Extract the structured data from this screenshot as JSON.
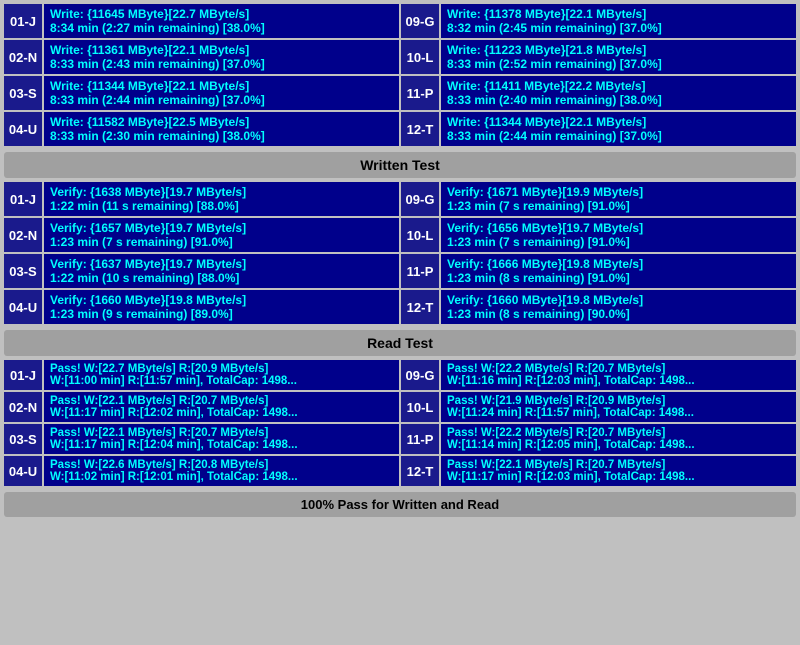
{
  "sections": {
    "write": {
      "label": "Written Test",
      "rows_left": [
        {
          "id": "01-J",
          "line1": "Write: {11645 MByte}[22.7 MByte/s]",
          "line2": "8:34 min (2:27 min remaining)  [38.0%]"
        },
        {
          "id": "02-N",
          "line1": "Write: {11361 MByte}[22.1 MByte/s]",
          "line2": "8:33 min (2:43 min remaining)  [37.0%]"
        },
        {
          "id": "03-S",
          "line1": "Write: {11344 MByte}[22.1 MByte/s]",
          "line2": "8:33 min (2:44 min remaining)  [37.0%]"
        },
        {
          "id": "04-U",
          "line1": "Write: {11582 MByte}[22.5 MByte/s]",
          "line2": "8:33 min (2:30 min remaining)  [38.0%]"
        }
      ],
      "rows_right": [
        {
          "id": "09-G",
          "line1": "Write: {11378 MByte}[22.1 MByte/s]",
          "line2": "8:32 min (2:45 min remaining)  [37.0%]"
        },
        {
          "id": "10-L",
          "line1": "Write: {11223 MByte}[21.8 MByte/s]",
          "line2": "8:33 min (2:52 min remaining)  [37.0%]"
        },
        {
          "id": "11-P",
          "line1": "Write: {11411 MByte}[22.2 MByte/s]",
          "line2": "8:33 min (2:40 min remaining)  [38.0%]"
        },
        {
          "id": "12-T",
          "line1": "Write: {11344 MByte}[22.1 MByte/s]",
          "line2": "8:33 min (2:44 min remaining)  [37.0%]"
        }
      ]
    },
    "verify": {
      "rows_left": [
        {
          "id": "01-J",
          "line1": "Verify: {1638 MByte}[19.7 MByte/s]",
          "line2": "1:22 min (11 s remaining)  [88.0%]"
        },
        {
          "id": "02-N",
          "line1": "Verify: {1657 MByte}[19.7 MByte/s]",
          "line2": "1:23 min (7 s remaining)  [91.0%]"
        },
        {
          "id": "03-S",
          "line1": "Verify: {1637 MByte}[19.7 MByte/s]",
          "line2": "1:22 min (10 s remaining)  [88.0%]"
        },
        {
          "id": "04-U",
          "line1": "Verify: {1660 MByte}[19.8 MByte/s]",
          "line2": "1:23 min (9 s remaining)  [89.0%]"
        }
      ],
      "rows_right": [
        {
          "id": "09-G",
          "line1": "Verify: {1671 MByte}[19.9 MByte/s]",
          "line2": "1:23 min (7 s remaining)  [91.0%]"
        },
        {
          "id": "10-L",
          "line1": "Verify: {1656 MByte}[19.7 MByte/s]",
          "line2": "1:23 min (7 s remaining)  [91.0%]"
        },
        {
          "id": "11-P",
          "line1": "Verify: {1666 MByte}[19.8 MByte/s]",
          "line2": "1:23 min (8 s remaining)  [91.0%]"
        },
        {
          "id": "12-T",
          "line1": "Verify: {1660 MByte}[19.8 MByte/s]",
          "line2": "1:23 min (8 s remaining)  [90.0%]"
        }
      ]
    },
    "read": {
      "label": "Read Test",
      "rows_left": [
        {
          "id": "01-J",
          "line1": "Pass! W:[22.7 MByte/s] R:[20.9 MByte/s]",
          "line2": "W:[11:00 min] R:[11:57 min], TotalCap: 1498..."
        },
        {
          "id": "02-N",
          "line1": "Pass! W:[22.1 MByte/s] R:[20.7 MByte/s]",
          "line2": "W:[11:17 min] R:[12:02 min], TotalCap: 1498..."
        },
        {
          "id": "03-S",
          "line1": "Pass! W:[22.1 MByte/s] R:[20.7 MByte/s]",
          "line2": "W:[11:17 min] R:[12:04 min], TotalCap: 1498..."
        },
        {
          "id": "04-U",
          "line1": "Pass! W:[22.6 MByte/s] R:[20.8 MByte/s]",
          "line2": "W:[11:02 min] R:[12:01 min], TotalCap: 1498..."
        }
      ],
      "rows_right": [
        {
          "id": "09-G",
          "line1": "Pass! W:[22.2 MByte/s] R:[20.7 MByte/s]",
          "line2": "W:[11:16 min] R:[12:03 min], TotalCap: 1498..."
        },
        {
          "id": "10-L",
          "line1": "Pass! W:[21.9 MByte/s] R:[20.9 MByte/s]",
          "line2": "W:[11:24 min] R:[11:57 min], TotalCap: 1498..."
        },
        {
          "id": "11-P",
          "line1": "Pass! W:[22.2 MByte/s] R:[20.7 MByte/s]",
          "line2": "W:[11:14 min] R:[12:05 min], TotalCap: 1498..."
        },
        {
          "id": "12-T",
          "line1": "Pass! W:[22.1 MByte/s] R:[20.7 MByte/s]",
          "line2": "W:[11:17 min] R:[12:03 min], TotalCap: 1498..."
        }
      ]
    }
  },
  "headers": {
    "written_test": "Written Test",
    "read_test": "Read Test"
  },
  "status": "100% Pass for Written and Read"
}
